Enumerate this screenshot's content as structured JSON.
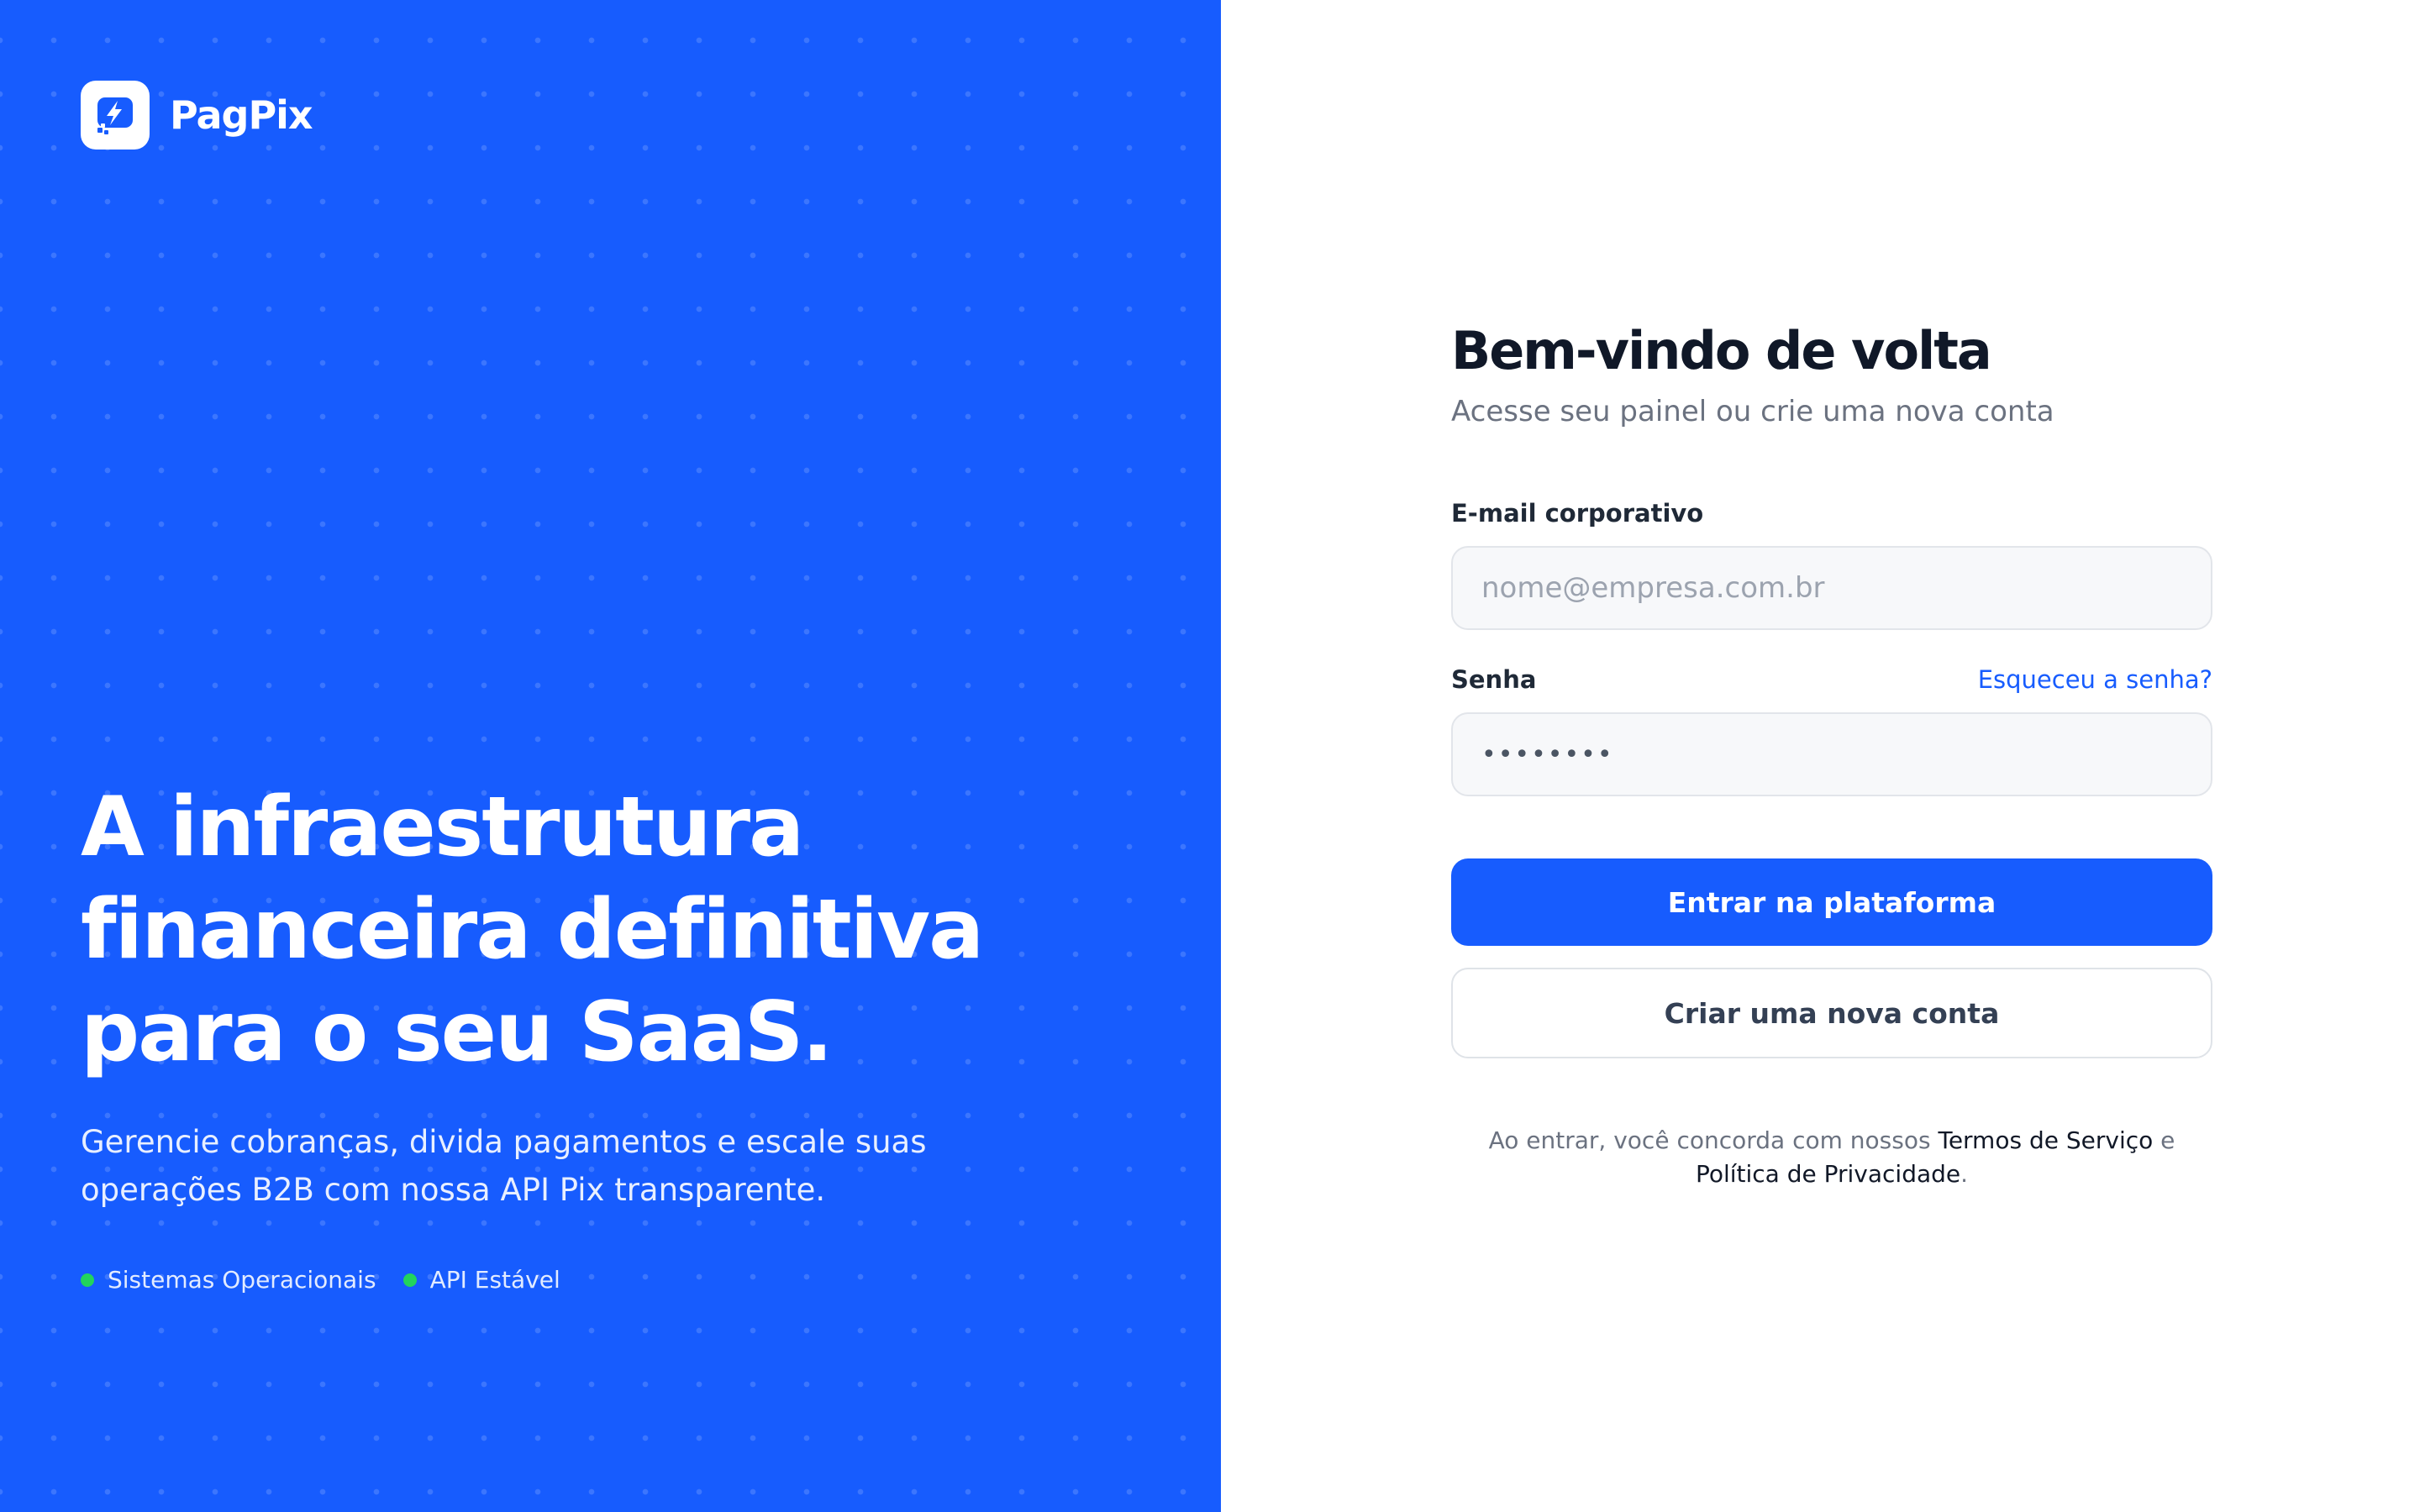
{
  "brand": {
    "name": "PagPix"
  },
  "hero": {
    "title_lines": [
      "A infraestrutura",
      "financeira definitiva",
      "para o seu SaaS."
    ],
    "subtitle_lines": [
      "Gerencie cobranças, divida pagamentos e escale suas",
      "operações B2B com nossa API Pix transparente."
    ]
  },
  "status": {
    "items": [
      {
        "label": "Sistemas Operacionais",
        "dot_color": "#22d45c"
      },
      {
        "label": "API Estável",
        "dot_color": "#22d45c"
      }
    ]
  },
  "login": {
    "title": "Bem-vindo de volta",
    "subtitle": "Acesse seu painel ou crie uma nova conta",
    "email": {
      "label": "E-mail corporativo",
      "placeholder": "nome@empresa.com.br",
      "value": ""
    },
    "password": {
      "label": "Senha",
      "forgot_link": "Esqueceu a senha?",
      "value": "••••••••"
    },
    "submit_label": "Entrar na plataforma",
    "create_account_label": "Criar uma nova conta",
    "legal": {
      "prefix": "Ao entrar, você concorda com nossos ",
      "terms_link": "Termos de Serviço",
      "conjunction": " e",
      "privacy_link": "Política de Privacidade",
      "suffix": "."
    }
  },
  "colors": {
    "brand_blue": "#175cfe",
    "status_green": "#22d45c",
    "heading_dark": "#101828",
    "muted_text": "#6b7280"
  }
}
